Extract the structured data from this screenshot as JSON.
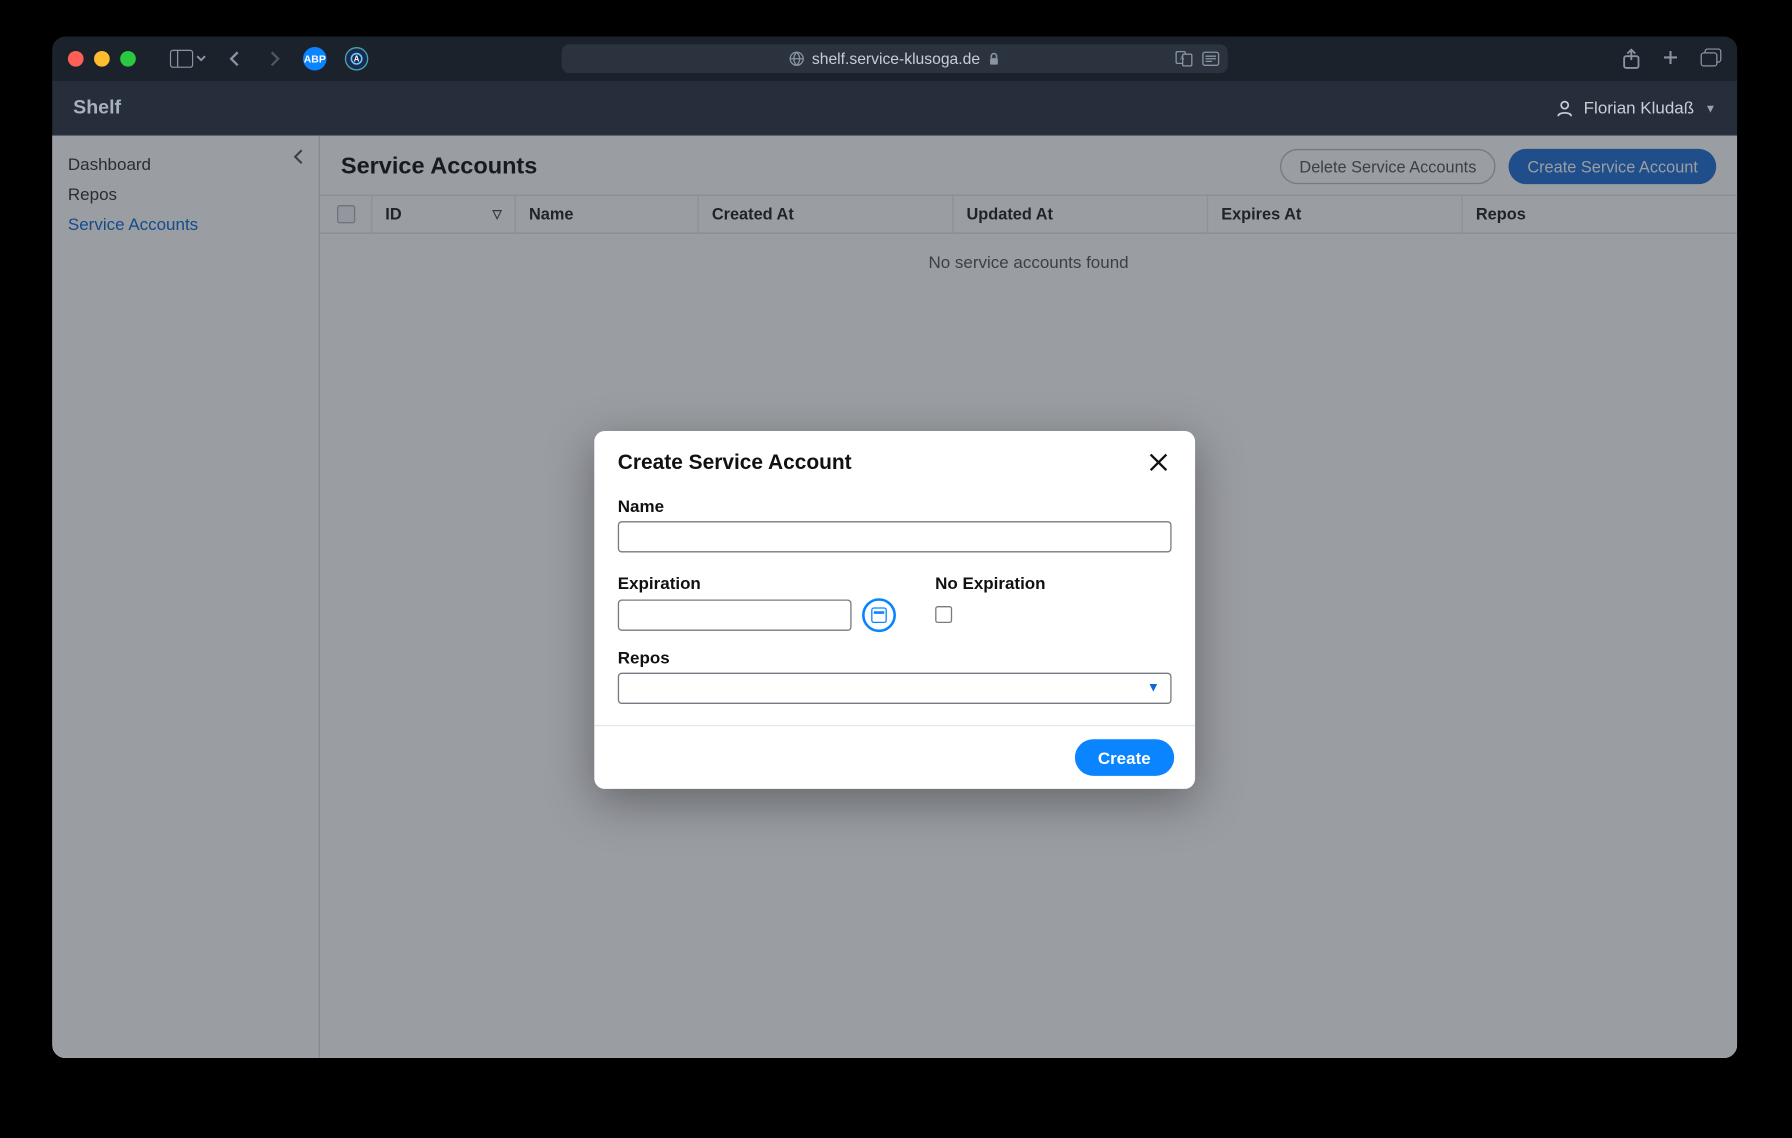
{
  "browser": {
    "url": "shelf.service-klusoga.de"
  },
  "header": {
    "brand": "Shelf",
    "username": "Florian Kludaß"
  },
  "sidebar": {
    "items": [
      {
        "label": "Dashboard",
        "active": false
      },
      {
        "label": "Repos",
        "active": false
      },
      {
        "label": "Service Accounts",
        "active": true
      }
    ]
  },
  "page": {
    "title": "Service Accounts",
    "actions": {
      "delete": "Delete Service Accounts",
      "create": "Create Service Account"
    },
    "columns": {
      "id": "ID",
      "name": "Name",
      "created": "Created At",
      "updated": "Updated At",
      "expires": "Expires At",
      "repos": "Repos"
    },
    "empty": "No service accounts found"
  },
  "modal": {
    "title": "Create Service Account",
    "name_label": "Name",
    "name_value": "",
    "expiration_label": "Expiration",
    "expiration_value": "",
    "no_expiration_label": "No Expiration",
    "repos_label": "Repos",
    "repos_value": "",
    "submit": "Create"
  }
}
